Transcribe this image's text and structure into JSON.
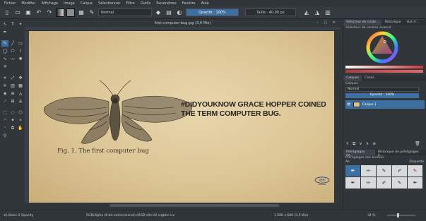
{
  "menu": [
    "Fichier",
    "Modifier",
    "Affichage",
    "Image",
    "Calque",
    "Sélectionner",
    "Filtre",
    "Outils",
    "Paramètres",
    "Fenêtre",
    "Aide"
  ],
  "toolbar": {
    "blend_mode": "Normal",
    "opacity": "Opacité : 100%",
    "size": "Taille : 40,00 px"
  },
  "document": {
    "title": "first-computer-bug.jpg (3,0 Mio)",
    "caption": "Fig. 1. The first computer bug",
    "headline_line1": "#DIDYOUKNOW GRACE HOPPER COINED",
    "headline_line2": "THE TERM COMPUTER BUG.",
    "logo_word": "intel",
    "logo_sub": "Software"
  },
  "dock": {
    "tabs_top": [
      "Sélecteur de coule…",
      "Historique",
      "Vue d'…"
    ],
    "color_title": "Sélecteur de couleur avancé",
    "tabs_mid": [
      "Calques",
      "Canal…"
    ],
    "layers_title": "Calques",
    "blend": "Normal",
    "opacity": "Opacité : 100%",
    "layer_name": "Calque 1",
    "tabs_bottom": [
      "Préréglages de…",
      "Historique de préréglages d…"
    ],
    "presets_title": "Préréglages des brosses",
    "presets_filter": "All",
    "presets_tag": "Étiquette"
  },
  "status": {
    "brush": "b) Basic-2 Opacity",
    "color_info": "RGB/Alpha (8 bit entiers/canal) sRGB-elle-V2-srgbtrc.icc",
    "dims": "1 500 x 600 (3,0 Mio)",
    "zoom": "34 %"
  },
  "colors": {
    "accent": "#3d6fa0",
    "paper": "#dcc595"
  }
}
